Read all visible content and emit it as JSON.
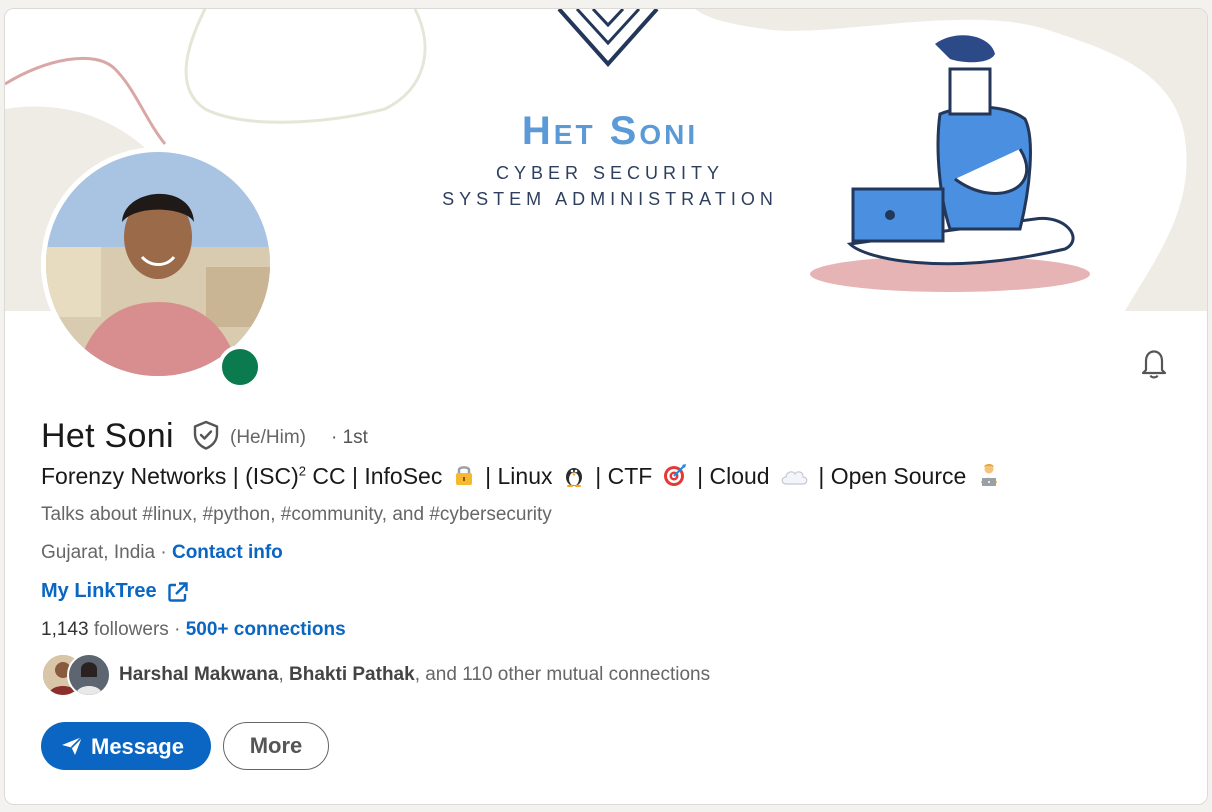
{
  "banner": {
    "title": "Het Soni",
    "subtitle_line1": "CYBER SECURITY",
    "subtitle_line2": "SYSTEM ADMINISTRATION"
  },
  "profile": {
    "name": "Het Soni",
    "pronouns": "(He/Him)",
    "degree": "· 1st",
    "headline_parts": [
      "Forenzy Networks | (ISC)",
      "2",
      " CC | InfoSec",
      "| Linux",
      "| CTF",
      "| Cloud",
      "| Open Source"
    ],
    "talks_about": "Talks about #linux, #python, #community, and #cybersecurity",
    "location": "Gujarat, India",
    "location_sep": " · ",
    "contact_info": "Contact info",
    "website": "My LinkTree",
    "followers_count": "1,143",
    "followers_label": "followers",
    "connections_sep": "  · ",
    "connections": "500+ connections",
    "mutual_name_1": "Harshal Makwana",
    "mutual_sep": ", ",
    "mutual_name_2": "Bhakti Pathak",
    "mutual_rest": ", and 110 other mutual connections"
  },
  "actions": {
    "message": "Message",
    "more": "More"
  },
  "icons": {
    "verified": "shield-check-icon",
    "bell": "bell-icon",
    "external": "external-link-icon",
    "send": "paper-plane-icon",
    "lock": "lock-emoji",
    "penguin": "penguin-emoji",
    "target": "target-emoji",
    "cloud": "cloud-emoji",
    "technologist": "technologist-emoji"
  },
  "colors": {
    "accent": "#0a66c2",
    "online": "#0b7a4e",
    "banner_title": "#5b9ad6"
  }
}
